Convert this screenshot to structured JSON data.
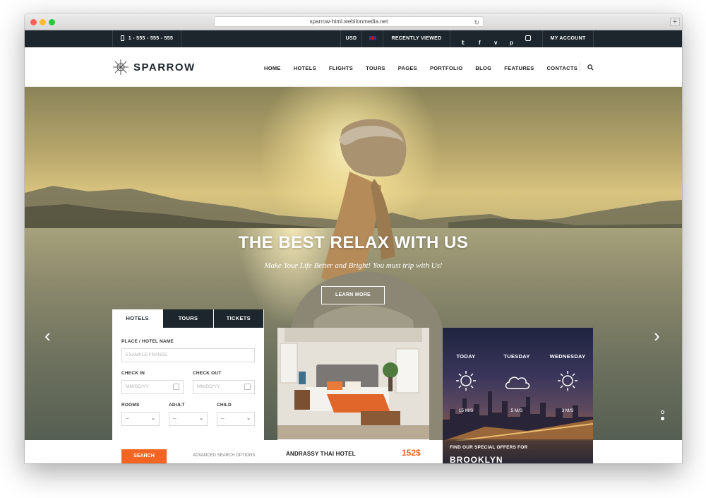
{
  "browser": {
    "url": "sparrow-html.webilonmedia.net"
  },
  "topbar": {
    "phone": "1 - 555 - 555 - 555",
    "currency": "USD",
    "recently_viewed": "RECENTLY VIEWED",
    "account": "MY ACCOUNT",
    "social_icons": [
      "twitter-icon",
      "facebook-icon",
      "vimeo-icon",
      "pinterest-icon",
      "instagram-icon"
    ]
  },
  "brand": {
    "name": "SPARROW"
  },
  "menu": [
    "HOME",
    "HOTELS",
    "FLIGHTS",
    "TOURS",
    "PAGES",
    "PORTFOLIO",
    "BLOG",
    "FEATURES",
    "CONTACTS"
  ],
  "hero": {
    "title": "THE BEST RELAX WITH US",
    "subtitle": "Make Your Life Better and Bright! You must trip with Us!",
    "cta": "LEARN MORE"
  },
  "search": {
    "tabs": [
      "HOTELS",
      "TOURS",
      "TICKETS"
    ],
    "place_label": "PLACE / HOTEL NAME",
    "place_placeholder": "EXAMPLE:FRANCE",
    "checkin_label": "CHECK IN",
    "checkin_placeholder": "MM/DD/YY",
    "checkout_label": "CHECK OUT",
    "checkout_placeholder": "MM/DD/YY",
    "rooms_label": "ROOMS",
    "adult_label": "ADULT",
    "child_label": "CHILD",
    "rooms_value": "–",
    "adult_value": "–",
    "child_value": "–",
    "button": "SEARCH",
    "advanced": "ADVANCED SEARCH OPTIONS"
  },
  "hotel": {
    "name": "ANDRASSY THAI HOTEL",
    "price": "152$"
  },
  "weather": {
    "days": [
      {
        "day": "TODAY",
        "wind": "15 M/S"
      },
      {
        "day": "TUESDAY",
        "wind": "5 M/S"
      },
      {
        "day": "WEDNESDAY",
        "wind": "3 M/S"
      }
    ],
    "offer_line": "FIND OUR SPECIAL OFFERS FOR",
    "offer_city": "BROOKLYN"
  },
  "colors": {
    "accent": "#f26522",
    "dark": "#1c262c"
  }
}
